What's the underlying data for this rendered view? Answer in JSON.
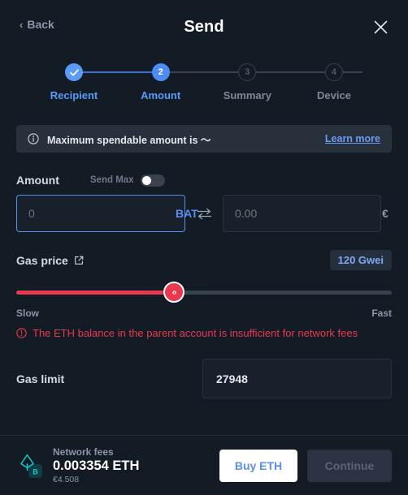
{
  "header": {
    "back_label": "Back",
    "back_chevron": "‹",
    "title": "Send",
    "close_icon": "close-icon"
  },
  "stepper": {
    "steps": [
      {
        "id": "recipient",
        "number": "✓",
        "label": "Recipient",
        "state": "done"
      },
      {
        "id": "amount",
        "number": "2",
        "label": "Amount",
        "state": "active"
      },
      {
        "id": "summary",
        "number": "3",
        "label": "Summary",
        "state": "todo"
      },
      {
        "id": "device",
        "number": "4",
        "label": "Device",
        "state": "todo"
      }
    ]
  },
  "banner": {
    "icon": "info-circle-icon",
    "text": "Maximum spendable amount is ～",
    "link": "Learn more"
  },
  "amount": {
    "label": "Amount",
    "send_max_label": "Send Max",
    "send_max_on": false,
    "crypto_value": "",
    "crypto_placeholder": "0",
    "crypto_unit": "BAT",
    "swap_icon": "swap-arrows-icon",
    "fiat_value": "",
    "fiat_placeholder": "0.00",
    "fiat_unit": "€"
  },
  "gas_price": {
    "label": "Gas price",
    "external_link_icon": "external-link-icon",
    "badge": "120 Gwei",
    "slider_percent": 42,
    "slider_min_label": "Slow",
    "slider_max_label": "Fast",
    "thumb_glyph": "‹›"
  },
  "error": {
    "icon": "error-circle-icon",
    "text": "The ETH balance in the parent account is insufficient for network fees"
  },
  "gas_limit": {
    "label": "Gas limit",
    "value": "27948"
  },
  "footer": {
    "coin_icon": "ethereum-bat-token-icon",
    "fees_title": "Network fees",
    "fees_amount": "0.003354 ETH",
    "fees_fiat": "€4.508",
    "buy_label": "Buy ETH",
    "continue_label": "Continue",
    "continue_disabled": true
  },
  "colors": {
    "background": "#131B25",
    "accent_blue": "#5B8DEF",
    "error_red": "#E9394F",
    "banner_bg": "#28303B",
    "token_cyan": "#19C7CF"
  }
}
